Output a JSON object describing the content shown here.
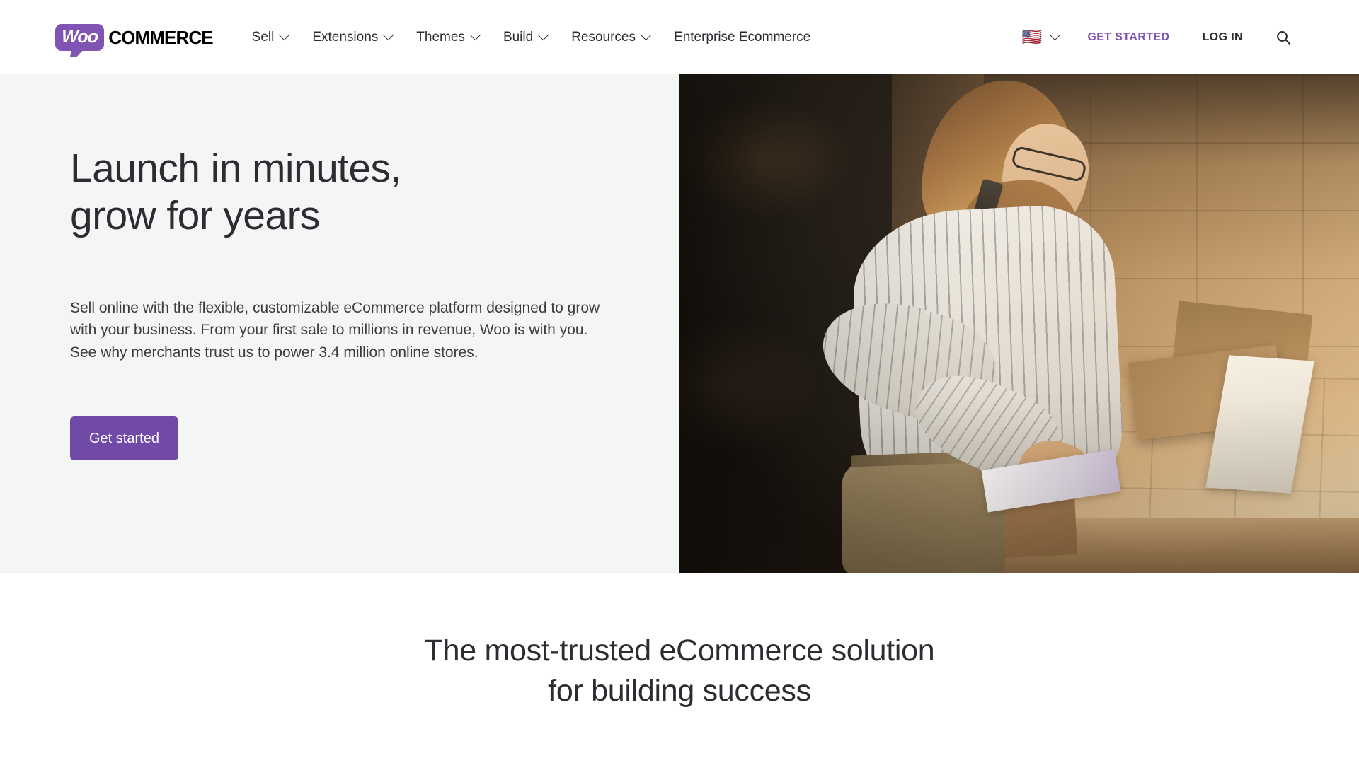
{
  "header": {
    "logo": {
      "mark": "Woo",
      "word": "COMMERCE",
      "alt": "WooCommerce"
    },
    "nav": [
      {
        "label": "Sell",
        "has_dropdown": true
      },
      {
        "label": "Extensions",
        "has_dropdown": true
      },
      {
        "label": "Themes",
        "has_dropdown": true
      },
      {
        "label": "Build",
        "has_dropdown": true
      },
      {
        "label": "Resources",
        "has_dropdown": true
      },
      {
        "label": "Enterprise Ecommerce",
        "has_dropdown": false
      }
    ],
    "locale": {
      "flag": "🇺🇸",
      "has_dropdown": true
    },
    "get_started_label": "GET STARTED",
    "login_label": "LOG IN",
    "search_icon": "search-icon",
    "accent_color": "#7f54b3",
    "text_color": "#2c2d33"
  },
  "hero": {
    "title": "Launch in minutes,\ngrow for years",
    "description": "Sell online with the flexible, customizable eCommerce platform designed to grow with your business. From your first sale to millions in revenue, Woo is with you. See why merchants trust us to power 3.4 million online stores.",
    "cta_label": "Get started",
    "cta_color": "#7149a6",
    "background_color": "#f4f5f5",
    "image_alt": "Woman on phone packing cardboard boxes in a warehouse"
  },
  "trust": {
    "title": "The most-trusted eCommerce solution\nfor building success"
  }
}
